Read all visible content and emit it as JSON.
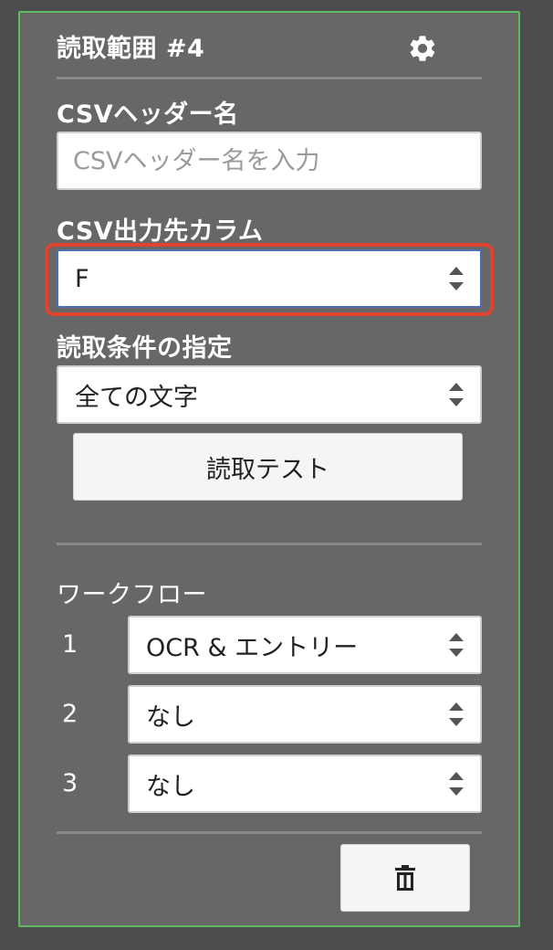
{
  "panel": {
    "title": "読取範囲 #4",
    "settings_icon": "gear-icon"
  },
  "csv_header": {
    "label": "CSVヘッダー名",
    "placeholder": "CSVヘッダー名を入力",
    "value": ""
  },
  "csv_column": {
    "label": "CSV出力先カラム",
    "selected": "F"
  },
  "read_condition": {
    "label": "読取条件の指定",
    "selected": "全ての文字"
  },
  "read_test_button": "読取テスト",
  "workflow": {
    "label": "ワークフロー",
    "steps": [
      {
        "number": "1",
        "selected": "OCR & エントリー"
      },
      {
        "number": "2",
        "selected": "なし"
      },
      {
        "number": "3",
        "selected": "なし"
      }
    ]
  },
  "delete_icon": "trash-icon",
  "colors": {
    "background": "#4d4d4d",
    "panel": "#686767",
    "panel_border": "#5fb95f",
    "highlight": "#e0432e",
    "focus_border": "#4b6fb2"
  }
}
